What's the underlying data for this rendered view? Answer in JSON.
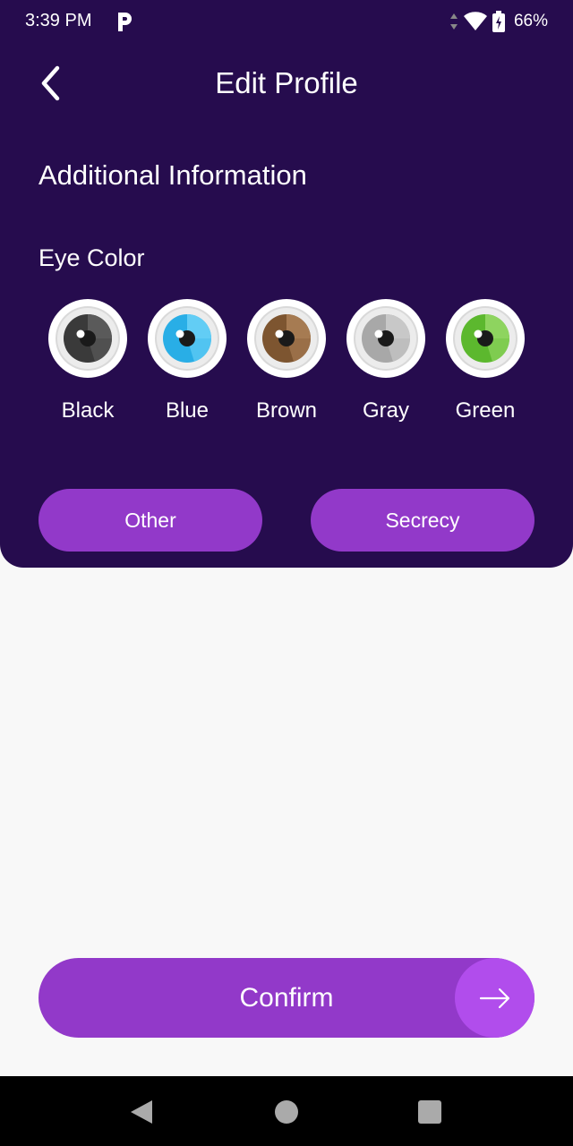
{
  "status_bar": {
    "time": "3:39 PM",
    "app_icon": "parking-p-icon",
    "battery_percent": "66%"
  },
  "header": {
    "title": "Edit Profile",
    "back_icon": "chevron-left-icon"
  },
  "section": {
    "title": "Additional Information",
    "eye_color_label": "Eye Color"
  },
  "eye_colors": [
    {
      "label": "Black",
      "iris": "#3a3a3a",
      "iris_light": "#5a5a5a"
    },
    {
      "label": "Blue",
      "iris": "#29aee6",
      "iris_light": "#62cdf5"
    },
    {
      "label": "Brown",
      "iris": "#7d5530",
      "iris_light": "#a67b52"
    },
    {
      "label": "Gray",
      "iris": "#a8a8a8",
      "iris_light": "#c8c8c8"
    },
    {
      "label": "Green",
      "iris": "#5cb82e",
      "iris_light": "#8ed45f"
    }
  ],
  "options": {
    "other_label": "Other",
    "secrecy_label": "Secrecy"
  },
  "confirm": {
    "label": "Confirm",
    "arrow_icon": "arrow-right-icon"
  },
  "colors": {
    "header_bg": "#260c4e",
    "accent": "#9239c9",
    "accent_light": "#b14dec"
  }
}
